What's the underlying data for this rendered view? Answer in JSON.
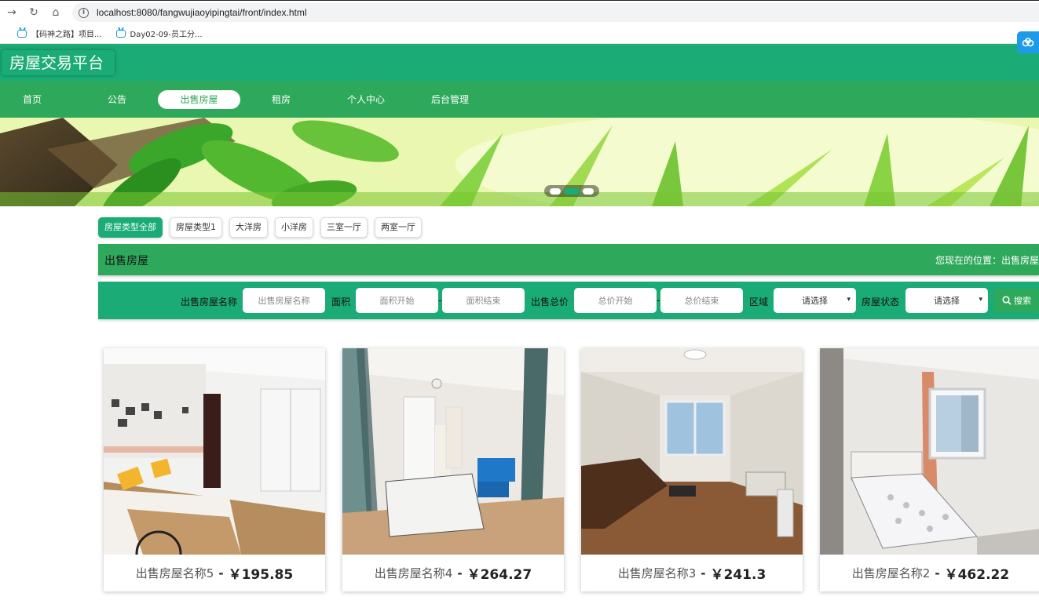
{
  "browser": {
    "url": "localhost:8080/fangwujiaoyipingtai/front/index.html",
    "bookmarks": [
      "【码神之路】项目...",
      "Day02-09-员工分..."
    ]
  },
  "site": {
    "title": "房屋交易平台"
  },
  "nav": {
    "items": [
      "首页",
      "公告",
      "出售房屋",
      "租房",
      "个人中心",
      "后台管理"
    ],
    "active_index": 2
  },
  "type_tabs": [
    "房屋类型全部",
    "房屋类型1",
    "大洋房",
    "小洋房",
    "三室一厅",
    "两室一厅"
  ],
  "section": {
    "title": "出售房屋",
    "breadcrumb_label": "您现在的位置：",
    "breadcrumb_current": "出售房屋"
  },
  "search": {
    "name_label": "出售房屋名称",
    "name_placeholder": "出售房屋名称",
    "area_label": "面积",
    "area_start_placeholder": "面积开始",
    "area_end_placeholder": "面积结束",
    "price_label": "出售总价",
    "price_start_placeholder": "总价开始",
    "price_end_placeholder": "总价结束",
    "region_label": "区域",
    "region_value": "请选择",
    "status_label": "房屋状态",
    "status_value": "请选择",
    "dash": "-",
    "button_label": "搜索"
  },
  "listings": [
    {
      "name": "出售房屋名称5",
      "sep": "-",
      "price": "￥195.85"
    },
    {
      "name": "出售房屋名称4",
      "sep": "-",
      "price": "￥264.27"
    },
    {
      "name": "出售房屋名称3",
      "sep": "-",
      "price": "￥241.3"
    },
    {
      "name": "出售房屋名称2",
      "sep": "-",
      "price": "￥462.22"
    }
  ],
  "colors": {
    "header_green": "#1aab76",
    "nav_green": "#2ea95b"
  }
}
